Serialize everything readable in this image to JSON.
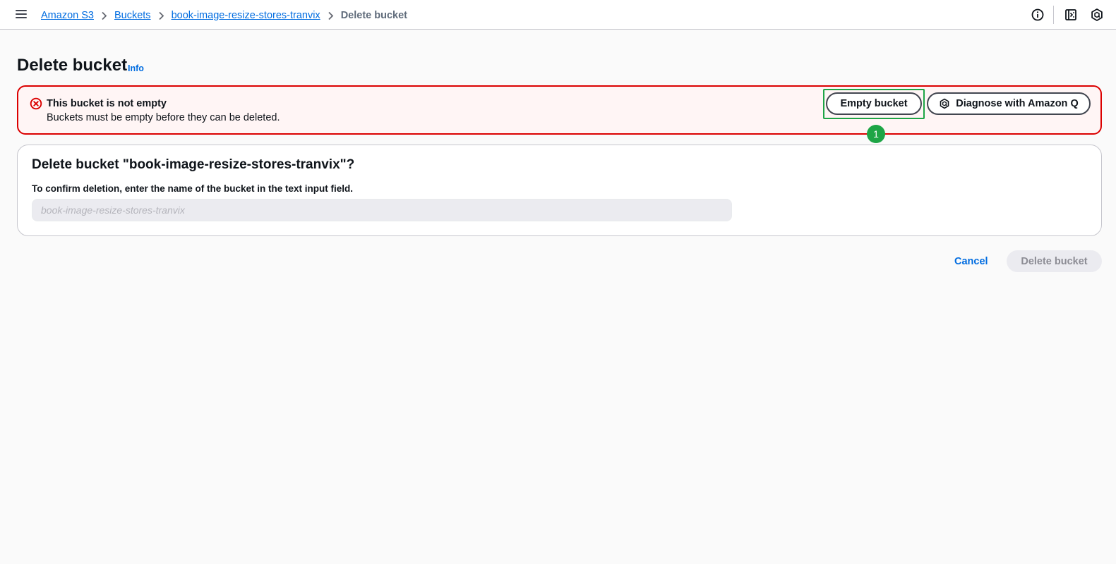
{
  "breadcrumb": {
    "items": [
      {
        "label": "Amazon S3"
      },
      {
        "label": "Buckets"
      },
      {
        "label": "book-image-resize-stores-tranvix"
      }
    ],
    "current": "Delete bucket"
  },
  "page": {
    "title": "Delete bucket",
    "info_label": "Info"
  },
  "alert": {
    "title": "This bucket is not empty",
    "message": "Buckets must be empty before they can be deleted.",
    "empty_button": "Empty bucket",
    "diagnose_button": "Diagnose with Amazon Q",
    "step_badge": "1"
  },
  "confirm": {
    "title": "Delete bucket \"book-image-resize-stores-tranvix\"?",
    "label": "To confirm deletion, enter the name of the bucket in the text input field.",
    "input_value": "",
    "input_placeholder": "book-image-resize-stores-tranvix"
  },
  "footer": {
    "cancel": "Cancel",
    "delete": "Delete bucket"
  },
  "colors": {
    "link": "#006ce0",
    "error": "#db0000",
    "highlight": "#1ea546"
  }
}
